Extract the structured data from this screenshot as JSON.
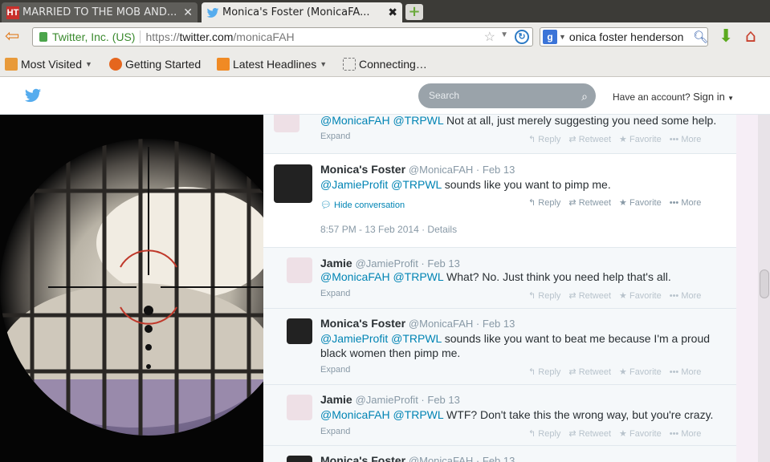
{
  "tabs": [
    {
      "label": "MARRIED TO THE MOB AND...",
      "favicon": "HT",
      "close": "✕"
    },
    {
      "label": "Monica's Foster (MonicaFA...",
      "close": "✖"
    }
  ],
  "new_tab": "+",
  "nav": {
    "site_identity": "Twitter, Inc. (US)",
    "url_scheme": "https://",
    "url_host": "twitter.com",
    "url_path": "/monicaFAH",
    "search_value": "onica foster henderson",
    "search_engine_letter": "g"
  },
  "bookmarks": [
    {
      "label": "Most Visited",
      "icon": "folder-icon",
      "has_dropdown": true
    },
    {
      "label": "Getting Started",
      "icon": "firefox-icon",
      "has_dropdown": false
    },
    {
      "label": "Latest Headlines",
      "icon": "rss-icon",
      "has_dropdown": true
    },
    {
      "label": "Connecting…",
      "icon": "loading-icon",
      "has_dropdown": false
    }
  ],
  "twitter_header": {
    "search_placeholder": "Search",
    "account_prompt": "Have an account?",
    "sign_in": "Sign in"
  },
  "tweets": [
    {
      "text_mentions": "@MonicaFAH @TRPWL",
      "text": "Not at all, just merely suggesting you need some help.",
      "expand": "Expand"
    },
    {
      "name": "Monica's Foster",
      "handle": "@MonicaFAH",
      "date": "Feb 13",
      "text_mentions": "@JamieProfit @TRPWL",
      "text": "sounds like you want to pimp me.",
      "hide": "Hide conversation",
      "timestamp": "8:57 PM - 13 Feb 2014",
      "details": "Details"
    },
    {
      "name": "Jamie",
      "handle": "@JamieProfit",
      "date": "Feb 13",
      "text_mentions": "@MonicaFAH @TRPWL",
      "text": "What? No.  Just think you need help that's all.",
      "expand": "Expand"
    },
    {
      "name": "Monica's Foster",
      "handle": "@MonicaFAH",
      "date": "Feb 13",
      "text_mentions": "@JamieProfit @TRPWL",
      "text": "sounds like you want to beat me because I'm a proud",
      "text2": "black women then pimp me.",
      "expand": "Expand"
    },
    {
      "name": "Jamie",
      "handle": "@JamieProfit",
      "date": "Feb 13",
      "text_mentions": "@MonicaFAH @TRPWL",
      "text": "WTF? Don't take this the wrong way, but you're crazy.",
      "expand": "Expand"
    },
    {
      "name": "Monica's Foster",
      "handle": "@MonicaFAH",
      "date": "Feb 13"
    }
  ],
  "actions": {
    "reply": "Reply",
    "retweet": "Retweet",
    "favorite": "Favorite",
    "more": "More"
  },
  "colors": {
    "link": "#0084b4",
    "muted": "#8899a6",
    "tab_bar": "#3c3b37",
    "toolbar": "#ecebe8"
  }
}
